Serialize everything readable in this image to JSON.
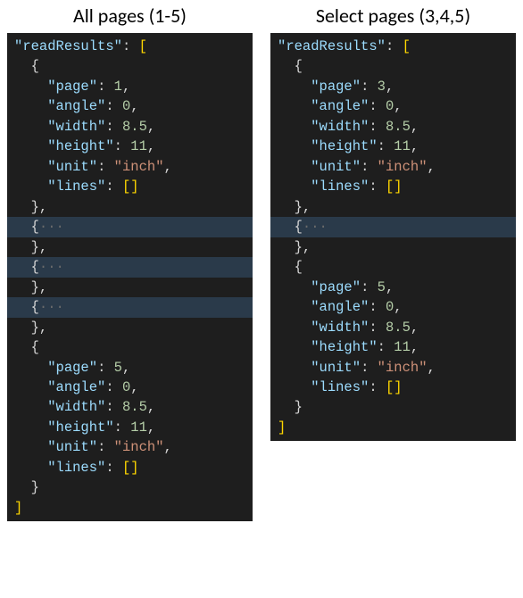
{
  "left": {
    "title": "All pages (1-5)",
    "rootKey": "readResults",
    "firstPage": {
      "page": 1,
      "angle": 0,
      "width": 8.5,
      "height": 11,
      "unit": "inch"
    },
    "lastPage": {
      "page": 5,
      "angle": 0,
      "width": 8.5,
      "height": 11,
      "unit": "inch"
    },
    "collapsedCount": 3
  },
  "right": {
    "title": "Select pages (3,4,5)",
    "rootKey": "readResults",
    "firstPage": {
      "page": 3,
      "angle": 0,
      "width": 8.5,
      "height": 11,
      "unit": "inch"
    },
    "lastPage": {
      "page": 5,
      "angle": 0,
      "width": 8.5,
      "height": 11,
      "unit": "inch"
    },
    "collapsedCount": 1
  },
  "labels": {
    "page": "page",
    "angle": "angle",
    "width": "width",
    "height": "height",
    "unit": "unit",
    "lines": "lines",
    "dots": "···"
  }
}
